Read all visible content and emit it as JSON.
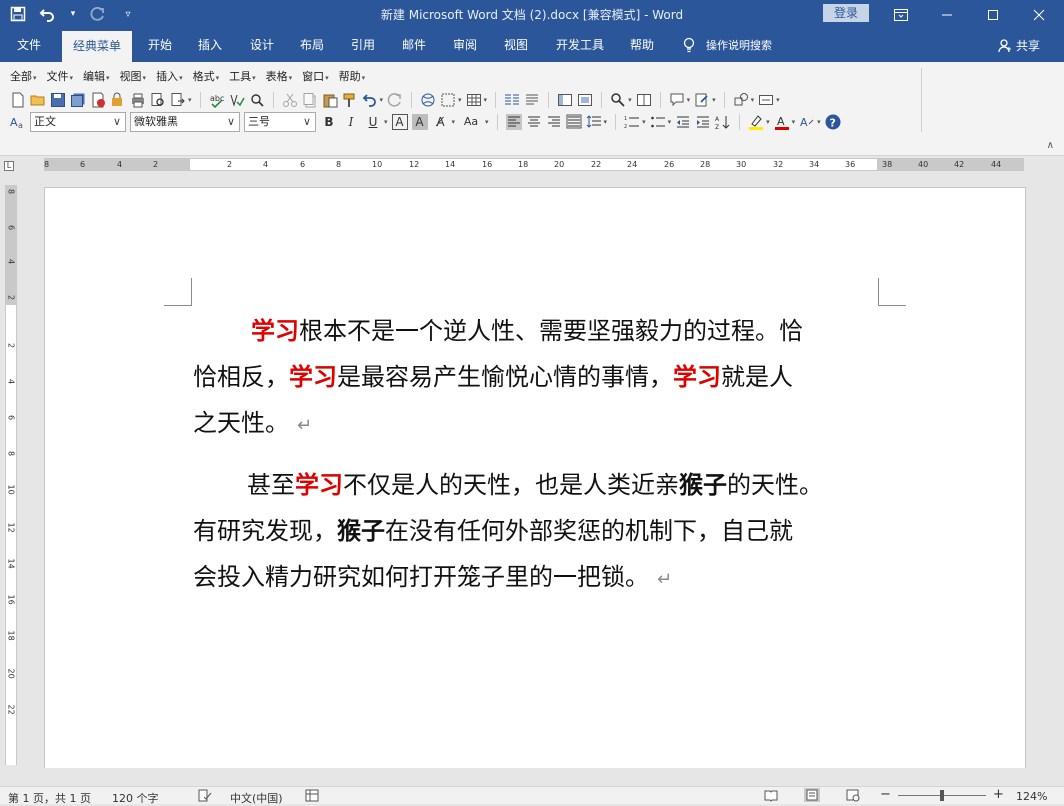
{
  "window": {
    "title": "新建 Microsoft Word 文档 (2).docx [兼容模式]  -  Word",
    "signin_label": "登录"
  },
  "tabs": [
    {
      "label": "文件"
    },
    {
      "label": "经典菜单"
    },
    {
      "label": "开始"
    },
    {
      "label": "插入"
    },
    {
      "label": "设计"
    },
    {
      "label": "布局"
    },
    {
      "label": "引用"
    },
    {
      "label": "邮件"
    },
    {
      "label": "审阅"
    },
    {
      "label": "视图"
    },
    {
      "label": "开发工具"
    },
    {
      "label": "帮助"
    }
  ],
  "tellme": {
    "label": "操作说明搜索"
  },
  "share_label": "共享",
  "classic_menu": [
    "全部",
    "文件",
    "编辑",
    "视图",
    "插入",
    "格式",
    "工具",
    "表格",
    "窗口",
    "帮助"
  ],
  "format": {
    "style": "正文",
    "font": "微软雅黑",
    "size": "三号"
  },
  "ruler": {
    "h_ticks": [
      "8",
      "6",
      "4",
      "2",
      "2",
      "4",
      "6",
      "8",
      "10",
      "12",
      "14",
      "16",
      "18",
      "20",
      "22",
      "24",
      "26",
      "28",
      "30",
      "32",
      "34",
      "36",
      "38",
      "40",
      "42",
      "44"
    ],
    "v_ticks": [
      "8",
      "6",
      "4",
      "2",
      "2",
      "4",
      "6",
      "8",
      "10",
      "12",
      "14",
      "16",
      "18",
      "20",
      "22"
    ]
  },
  "document": {
    "p1": {
      "l1_a": "学习",
      "l1_b": "根本不是一个逆人性、需要坚强毅力的过程。恰",
      "l2_a": "恰相反，",
      "l2_b": "学习",
      "l2_c": "是最容易产生愉悦心情的事情，",
      "l2_d": "学习",
      "l2_e": "就是人",
      "l3_a": "之天性。",
      "mark": "↵"
    },
    "p2": {
      "l1_a": "甚至",
      "l1_b": "学习",
      "l1_c": "不仅是人的天性，也是人类近亲",
      "l1_d": "猴子",
      "l1_e": "的天性。",
      "l2_a": "有研究发现，",
      "l2_b": "猴子",
      "l2_c": "在没有任何外部奖惩的机制下，自己就",
      "l3_a": "会投入精力研究如何打开笼子里的一把锁。",
      "mark": "↵"
    }
  },
  "status": {
    "page": "第 1 页，共 1 页",
    "words": "120 个字",
    "language": "中文(中国)",
    "zoom": "124%"
  }
}
